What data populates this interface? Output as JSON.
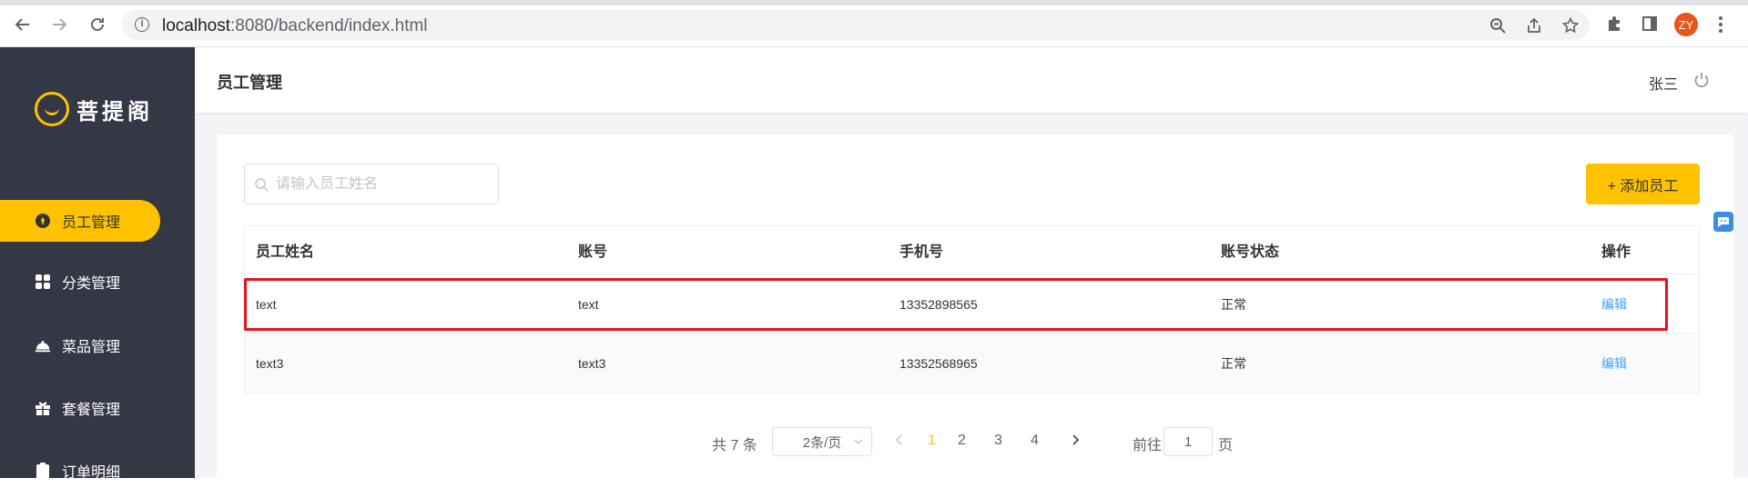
{
  "browser": {
    "url_host": "localhost",
    "url_path": ":8080/backend/index.html",
    "profile_initials": "ZY"
  },
  "sidebar": {
    "logo_text": "菩提阁",
    "items": [
      {
        "label": "员工管理",
        "icon": "employee-icon",
        "active": true
      },
      {
        "label": "分类管理",
        "icon": "category-grid-icon",
        "active": false
      },
      {
        "label": "菜品管理",
        "icon": "dish-cloche-icon",
        "active": false
      },
      {
        "label": "套餐管理",
        "icon": "gift-icon",
        "active": false
      },
      {
        "label": "订单明细",
        "icon": "order-icon",
        "active": false
      }
    ]
  },
  "header": {
    "title": "员工管理",
    "user": "张三"
  },
  "search": {
    "placeholder": "请输入员工姓名",
    "value": ""
  },
  "add_button": "+ 添加员工",
  "table": {
    "columns": [
      "员工姓名",
      "账号",
      "手机号",
      "账号状态",
      "操作"
    ],
    "rows": [
      {
        "name": "text",
        "account": "text",
        "phone": "13352898565",
        "status": "正常",
        "action": "编辑"
      },
      {
        "name": "text3",
        "account": "text3",
        "phone": "13352568965",
        "status": "正常",
        "action": "编辑"
      }
    ]
  },
  "pagination": {
    "total_text": "共 7 条",
    "page_size": "2条/页",
    "pages": [
      "1",
      "2",
      "3",
      "4"
    ],
    "current_page": "1",
    "goto_label": "前往",
    "goto_value": "1",
    "goto_suffix": "页"
  },
  "colors": {
    "accent": "#ffc200",
    "sidebar_bg": "#343744",
    "link": "#419eff",
    "highlight": "#e3141c"
  }
}
